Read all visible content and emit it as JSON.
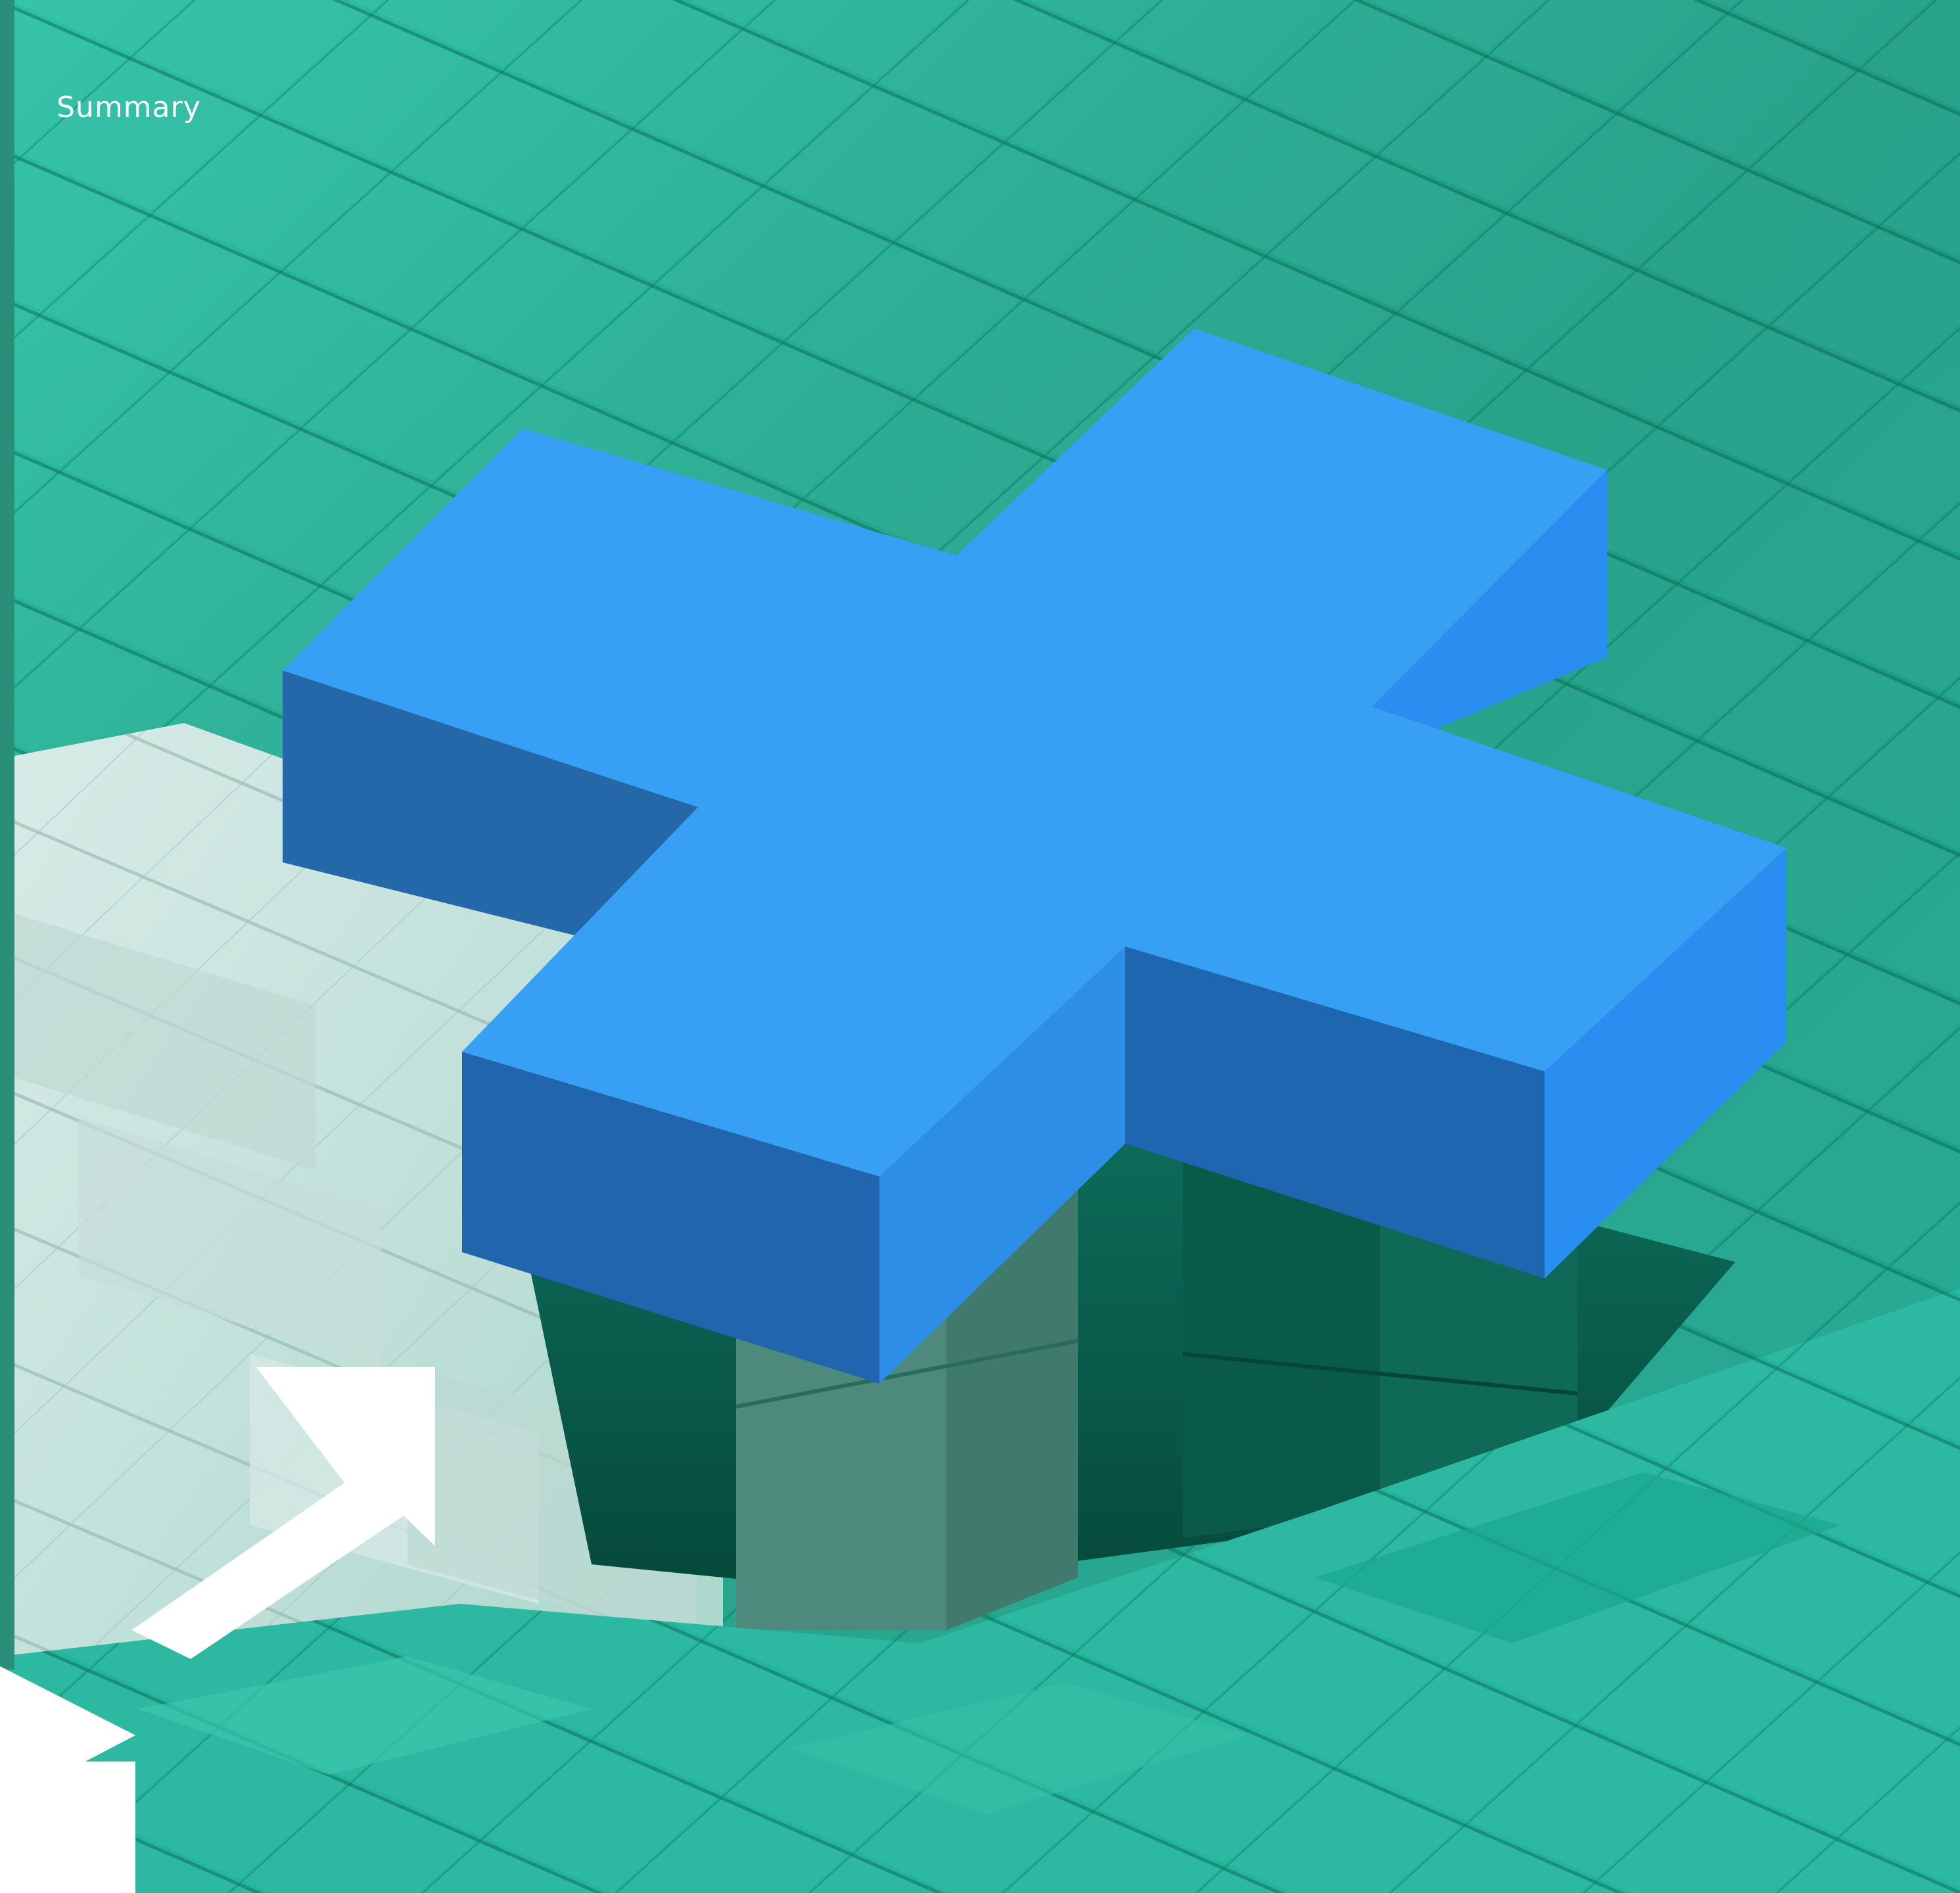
{
  "label": {
    "text": "Summary"
  },
  "colors": {
    "teal_bg": "#1f9f86",
    "teal_light": "#2ac2a6",
    "teal_dark": "#127a66",
    "pale_cube": "#cfe6e1",
    "plus_top": "#379ff4",
    "plus_side_dark": "#2267ad",
    "plus_side_light": "#2d8fe6",
    "arrow": "#ffffff",
    "left_strip": "#2a8f78"
  },
  "icons": {
    "plus": "plus-icon",
    "arrow": "arrow-up-right-icon",
    "play": "play-triangle-icon"
  }
}
